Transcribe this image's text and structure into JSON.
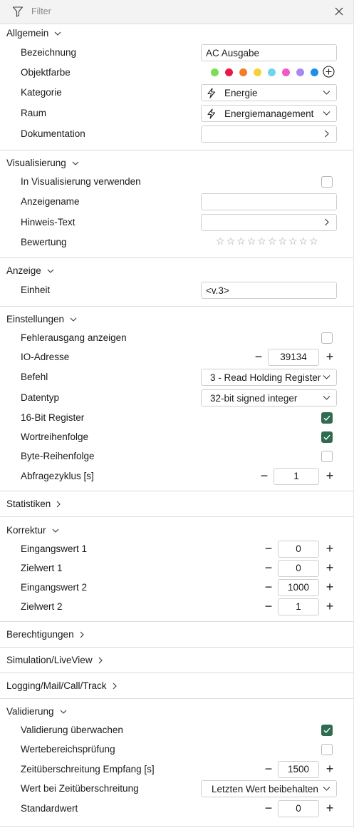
{
  "filter": {
    "placeholder": "Filter"
  },
  "sections": {
    "allgemein": "Allgemein",
    "visualisierung": "Visualisierung",
    "anzeige": "Anzeige",
    "einstellungen": "Einstellungen",
    "statistiken": "Statistiken",
    "korrektur": "Korrektur",
    "berechtigungen": "Berechtigungen",
    "simulation": "Simulation/LiveView",
    "logging": "Logging/Mail/Call/Track",
    "validierung": "Validierung"
  },
  "allgemein": {
    "bezeichnung_label": "Bezeichnung",
    "bezeichnung_value": "AC Ausgabe",
    "objektfarbe_label": "Objektfarbe",
    "colors": [
      "#7ddc5a",
      "#e8194a",
      "#f47c28",
      "#f4d33a",
      "#6fd3ee",
      "#f05ac6",
      "#a78af0",
      "#1e8fe8"
    ],
    "kategorie_label": "Kategorie",
    "kategorie_value": "Energie",
    "raum_label": "Raum",
    "raum_value": "Energiemanagement",
    "dokumentation_label": "Dokumentation"
  },
  "visualisierung": {
    "verwenden_label": "In Visualisierung verwenden",
    "verwenden_checked": false,
    "anzeigename_label": "Anzeigename",
    "anzeigename_value": "",
    "hinweis_label": "Hinweis-Text",
    "bewertung_label": "Bewertung",
    "bewertung_stars": 10,
    "bewertung_value": 0
  },
  "anzeige": {
    "einheit_label": "Einheit",
    "einheit_value": "<v.3>"
  },
  "einstellungen": {
    "fehler_label": "Fehlerausgang anzeigen",
    "fehler_checked": false,
    "io_label": "IO-Adresse",
    "io_value": "39134",
    "befehl_label": "Befehl",
    "befehl_value": "3 - Read Holding Register",
    "datentyp_label": "Datentyp",
    "datentyp_value": "32-bit signed integer",
    "reg16_label": "16-Bit Register",
    "reg16_checked": true,
    "wort_label": "Wortreihenfolge",
    "wort_checked": true,
    "byte_label": "Byte-Reihenfolge",
    "byte_checked": false,
    "zyklus_label": "Abfragezyklus [s]",
    "zyklus_value": "1"
  },
  "korrektur": {
    "ein1_label": "Eingangswert 1",
    "ein1_value": "0",
    "ziel1_label": "Zielwert 1",
    "ziel1_value": "0",
    "ein2_label": "Eingangswert 2",
    "ein2_value": "1000",
    "ziel2_label": "Zielwert 2",
    "ziel2_value": "1"
  },
  "validierung": {
    "ueberwachen_label": "Validierung überwachen",
    "ueberwachen_checked": true,
    "bereich_label": "Wertebereichsprüfung",
    "bereich_checked": false,
    "zeit_label": "Zeitüberschreitung Empfang [s]",
    "zeit_value": "1500",
    "wertbei_label": "Wert bei Zeitüberschreitung",
    "wertbei_value": "Letzten Wert beibehalten",
    "standard_label": "Standardwert",
    "standard_value": "0"
  },
  "stepper": {
    "minus": "−",
    "plus": "+"
  },
  "icons": {
    "star": "☆"
  }
}
